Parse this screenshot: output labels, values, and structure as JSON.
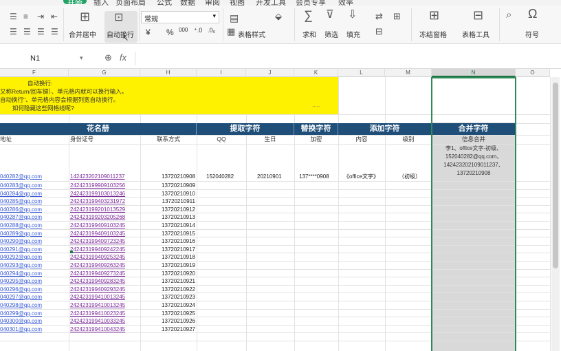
{
  "menu": {
    "items": [
      "开始",
      "插入",
      "页面布局",
      "公式",
      "数据",
      "审阅",
      "视图",
      "开发工具",
      "会员专享",
      "效率"
    ],
    "active_index": 0
  },
  "ribbon": {
    "font_name": "常规",
    "merge_center": "合并居中",
    "wrap_text": "自动换行",
    "currency": "¥",
    "percent": "%",
    "thousands": "000",
    "table_style": "表格样式",
    "sum": "求和",
    "filter": "筛选",
    "fill": "填充",
    "freeze": "冻结窗格",
    "table_tools": "表格工具",
    "symbol": "符号"
  },
  "formula_bar": {
    "cell_ref": "N1",
    "fx": "fx",
    "value": ""
  },
  "columns": [
    "F",
    "G",
    "H",
    "I",
    "J",
    "K",
    "L",
    "M",
    "N",
    "O"
  ],
  "selected_column": "N",
  "note": {
    "lines": [
      "自动换行:",
      "又称Return/回车键）、单元格内就可以换行输入。",
      "自动换行\"、单元格内容会根据列宽自动换行。",
      "如何隐藏这些网格线呢?"
    ],
    "dots": "....."
  },
  "headers": {
    "roster": "花名册",
    "extract": "提取字符",
    "replace": "替换字符",
    "add": "添加字符",
    "merge": "合并字符"
  },
  "subheaders": {
    "address": "地址",
    "id": "身份证号",
    "phone": "联系方式",
    "qq": "QQ",
    "birthday": "生日",
    "encrypt": "加密",
    "content": "内容",
    "level": "级别",
    "merged_info": "信息合并"
  },
  "first_row": {
    "email": "040282@qq.com",
    "id": "142423202109011237",
    "phone": "13720210908",
    "qq": "152040282",
    "birthday": "20210901",
    "encrypted": "137****0908",
    "content": "《office文字》",
    "level": "（初级）"
  },
  "merged_text": [
    "李1、office文字-初级、",
    "152040282@qq.com、",
    "142423202109011237、",
    "13720210908"
  ],
  "rows": [
    {
      "email": "040283@qq.com",
      "id": "242423199909103256",
      "phone": "13720210909"
    },
    {
      "email": "040284@qq.com",
      "id": "242423199103013246",
      "phone": "13720210910"
    },
    {
      "email": "040285@qq.com",
      "id": "242423199403231972",
      "phone": "13720210911"
    },
    {
      "email": "040286@qq.com",
      "id": "242423199201013529",
      "phone": "13720210912"
    },
    {
      "email": "040287@qq.com",
      "id": "242423199203205268",
      "phone": "13720210913"
    },
    {
      "email": "040288@qq.com",
      "id": "242423199409103245",
      "phone": "13720210914"
    },
    {
      "email": "040289@qq.com",
      "id": "242423199409103245",
      "phone": "13720210915"
    },
    {
      "email": "040290@qq.com",
      "id": "242423199409723245",
      "phone": "13720210916"
    },
    {
      "email": "040291@qq.com",
      "id": "242423199409242245",
      "phone": "13720210917"
    },
    {
      "email": "040292@qq.com",
      "id": "242423199409253245",
      "phone": "13720210918"
    },
    {
      "email": "040293@qq.com",
      "id": "242423199409263245",
      "phone": "13720210919"
    },
    {
      "email": "040294@qq.com",
      "id": "242423199409273245",
      "phone": "13720210920"
    },
    {
      "email": "040295@qq.com",
      "id": "242423199409283245",
      "phone": "13720210921"
    },
    {
      "email": "040296@qq.com",
      "id": "242423199409293245",
      "phone": "13720210922"
    },
    {
      "email": "040297@qq.com",
      "id": "242423199410013245",
      "phone": "13720210923"
    },
    {
      "email": "040298@qq.com",
      "id": "242423199410013245",
      "phone": "13720210924"
    },
    {
      "email": "040299@qq.com",
      "id": "242423199410023245",
      "phone": "13720210925"
    },
    {
      "email": "040300@qq.com",
      "id": "242423199410033245",
      "phone": "13720210926"
    },
    {
      "email": "040301@qq.com",
      "id": "242423199410043245",
      "phone": "13720210927"
    }
  ]
}
